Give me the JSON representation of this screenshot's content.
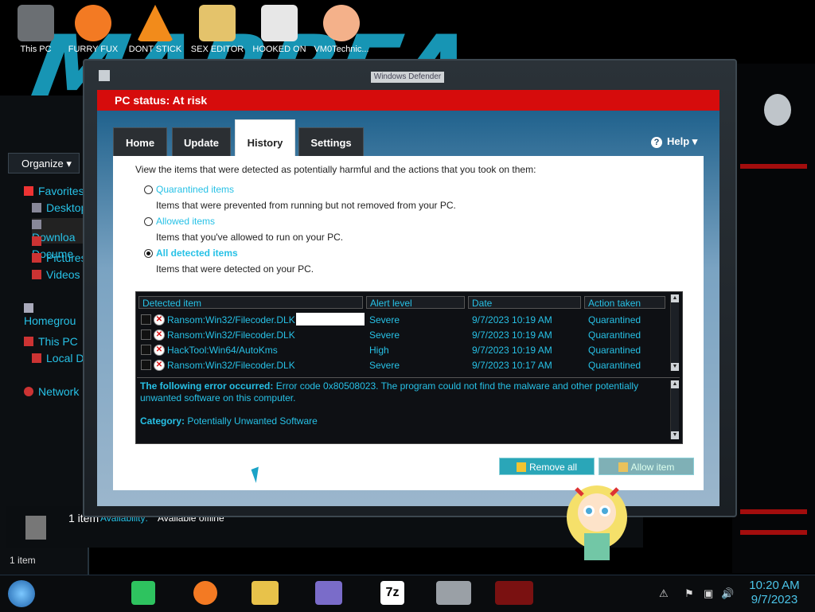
{
  "desktop_icons": [
    {
      "label": "This PC",
      "color": "#6b6f73"
    },
    {
      "label": "FURRY FUX",
      "color": "#f37a23"
    },
    {
      "label": "DONT STICK",
      "color": "#f28b1b"
    },
    {
      "label": "SEX EDITOR",
      "color": "#e4c36b"
    },
    {
      "label": "HOOKED ON",
      "color": "#e7e7e7"
    },
    {
      "label": "VM0Technic...",
      "color": "#f4b18a"
    }
  ],
  "explorer": {
    "organize_label": "Organize",
    "nav": {
      "favorites": "Favorites",
      "desktop": "Desktop",
      "downloads": "Downloa",
      "documents": "Docume",
      "pictures": "Pictures",
      "videos": "Videos",
      "homegroup": "Homegrou",
      "this_pc": "This PC",
      "local_disk": "Local Di",
      "network": "Network"
    },
    "details": {
      "count": "1 item",
      "availability_label": "Availability:",
      "availability_value": "Available offline"
    },
    "status": "1 item"
  },
  "defender": {
    "window_title": "Windows Defender",
    "status": "PC status: At risk",
    "tabs": [
      "Home",
      "Update",
      "History",
      "Settings"
    ],
    "active_tab": "History",
    "help_label": "Help",
    "intro": "View the items that were detected as potentially harmful and the actions that you took on them:",
    "options": [
      {
        "label": "Quarantined items",
        "desc": "Items that were prevented from running but not removed from your PC."
      },
      {
        "label": "Allowed items",
        "desc": "Items that you've allowed to run on your PC."
      },
      {
        "label": "All detected items",
        "desc": "Items that were detected on your PC."
      }
    ],
    "columns": [
      "Detected item",
      "Alert level",
      "Date",
      "Action taken"
    ],
    "rows": [
      {
        "item": "Ransom:Win32/Filecoder.DLK",
        "level": "Severe",
        "date": "9/7/2023 10:19 AM",
        "action": "Quarantined"
      },
      {
        "item": "Ransom:Win32/Filecoder.DLK",
        "level": "Severe",
        "date": "9/7/2023 10:19 AM",
        "action": "Quarantined"
      },
      {
        "item": "HackTool:Win64/AutoKms",
        "level": "High",
        "date": "9/7/2023 10:19 AM",
        "action": "Quarantined"
      },
      {
        "item": "Ransom:Win32/Filecoder.DLK",
        "level": "Severe",
        "date": "9/7/2023 10:17 AM",
        "action": "Quarantined"
      }
    ],
    "error_label": "The following error occurred:",
    "error_text": "Error code 0x80508023. The program could not find the malware and other potentially unwanted software on this computer.",
    "category_label": "Category:",
    "category_value": "Potentially Unwanted Software",
    "remove_all": "Remove all",
    "allow_item": "Allow item"
  },
  "taskbar": {
    "time": "10:20 AM",
    "date": "9/7/2023"
  },
  "colors": {
    "accent": "#27c1e6",
    "status_red": "#d60c0c"
  }
}
